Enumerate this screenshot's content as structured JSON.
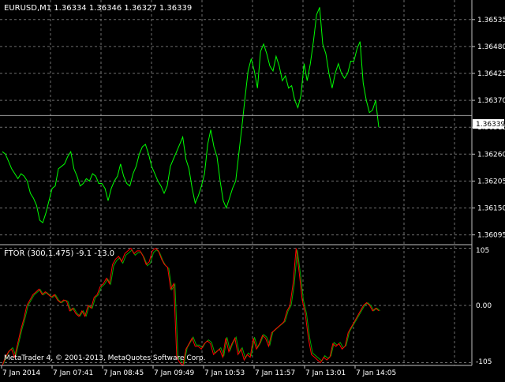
{
  "main_chart": {
    "header": "EURUSD,M1  1.36334 1.36346 1.36327 1.36339",
    "price_labels": [
      "1.36535",
      "1.36480",
      "1.36425",
      "1.36370",
      "1.36315",
      "1.36260",
      "1.36205",
      "1.36150",
      "1.36095"
    ],
    "current_price": "1.36339",
    "line_color": "#00ff00",
    "grid_color": "#808080",
    "background": "#000000"
  },
  "indicator": {
    "header": "FTOR (300,1.475) -9.1 -13.0",
    "levels": [
      "105",
      "0.00",
      "-105"
    ],
    "colors": {
      "up": "#00aa00",
      "down": "#ff0000"
    }
  },
  "time_axis": [
    "7 Jan 2014",
    "7 Jan 07:41",
    "7 Jan 08:45",
    "7 Jan 09:49",
    "7 Jan 10:53",
    "7 Jan 11:57",
    "7 Jan 13:01",
    "7 Jan 14:05"
  ],
  "copyright": "MetaTrader 4, © 2001-2013, MetaQuotes Software Corp.",
  "chart_data": [
    {
      "type": "line",
      "series": [
        {
          "values": [
            1.36265,
            1.3626,
            1.36245,
            1.3623,
            1.3622,
            1.3621,
            1.3622,
            1.36215,
            1.36205,
            1.3618,
            1.3617,
            1.36155,
            1.36125,
            1.3612,
            1.3614,
            1.36165,
            1.3619,
            1.36195,
            1.3623,
            1.36235,
            1.3624,
            1.36255,
            1.36265,
            1.3623,
            1.36215,
            1.36195,
            1.362,
            1.3621,
            1.36205,
            1.3622,
            1.36215,
            1.362,
            1.362,
            1.3619,
            1.36165,
            1.3619,
            1.36205,
            1.36215,
            1.3624,
            1.36215,
            1.362,
            1.36195,
            1.3622,
            1.36235,
            1.3626,
            1.36275,
            1.3628,
            1.3626,
            1.36235,
            1.3622,
            1.36205,
            1.36195,
            1.3618,
            1.36195,
            1.36235,
            1.3625,
            1.36265,
            1.3628,
            1.36295,
            1.3625,
            1.3623,
            1.3619,
            1.3616,
            1.36175,
            1.36195,
            1.3622,
            1.3628,
            1.3631,
            1.36275,
            1.36255,
            1.36205,
            1.36165,
            1.3615,
            1.3617,
            1.3619,
            1.36205,
            1.3626,
            1.36315,
            1.36375,
            1.3643,
            1.36455,
            1.3643,
            1.36395,
            1.3647,
            1.36485,
            1.36465,
            1.3644,
            1.3643,
            1.3646,
            1.3644,
            1.3641,
            1.3642,
            1.36395,
            1.364,
            1.3637,
            1.36355,
            1.3638,
            1.36445,
            1.3641,
            1.36445,
            1.3649,
            1.36545,
            1.3656,
            1.36485,
            1.36465,
            1.36425,
            1.36395,
            1.36425,
            1.36445,
            1.36425,
            1.36415,
            1.36425,
            1.3645,
            1.3645,
            1.36475,
            1.3649,
            1.36405,
            1.3637,
            1.36345,
            1.3635,
            1.3637,
            1.36315
          ],
          "name": ""
        }
      ],
      "ylim": [
        1.36075,
        1.36575
      ]
    },
    {
      "type": "line",
      "series": [
        {
          "values": [
            -110,
            -95,
            -85,
            -80,
            -95,
            -70,
            -45,
            -25,
            0,
            10,
            20,
            25,
            30,
            20,
            25,
            20,
            15,
            20,
            10,
            5,
            10,
            8,
            -10,
            -5,
            -15,
            -20,
            -10,
            -20,
            0,
            -5,
            15,
            20,
            35,
            40,
            50,
            40,
            75,
            85,
            90,
            80,
            95,
            100,
            105,
            95,
            100,
            100,
            90,
            75,
            80,
            100,
            105,
            100,
            85,
            75,
            70,
            30,
            40,
            -95,
            -105,
            -110,
            -80,
            -70,
            -60,
            -75,
            -75,
            -80,
            -70,
            -65,
            -70,
            -90,
            -85,
            -80,
            -95,
            -60,
            -85,
            -70,
            -60,
            -90,
            -80,
            -100,
            -90,
            -95,
            -60,
            -80,
            -70,
            -55,
            -60,
            -75,
            -50,
            -45,
            -40,
            -35,
            -30,
            -10,
            0,
            40,
            105,
            60,
            10,
            -15,
            -60,
            -90,
            -95,
            -100,
            -105,
            -95,
            -100,
            -95,
            -70,
            -75,
            -70,
            -80,
            -75,
            -50,
            -40,
            -30,
            -20,
            -10,
            0,
            5,
            0,
            -10,
            -5,
            -10
          ],
          "name": ""
        }
      ],
      "ylim": [
        -110,
        110
      ],
      "levels": [
        105,
        0,
        -105
      ]
    }
  ]
}
